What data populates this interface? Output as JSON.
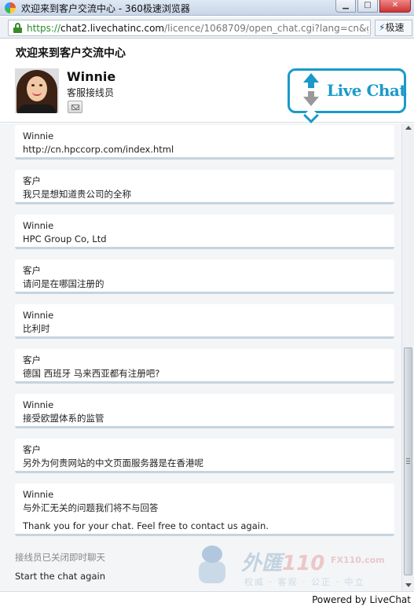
{
  "window": {
    "title": "欢迎来到客户交流中心 - 360极速浏览器",
    "minimize_icon": "minimize-icon",
    "maximize_icon": "maximize-icon",
    "close_icon": "close-icon"
  },
  "address_bar": {
    "protocol": "https://",
    "host": "chat2.livechatinc.com",
    "path": "/licence/1068709/open_chat.cgi?lang=cn&grou",
    "speed_button_icon": "lightning-icon",
    "speed_button_label": "极速"
  },
  "header": {
    "welcome": "欢迎来到客户交流中心",
    "agent_name": "Winnie",
    "agent_role": "客服接线员",
    "logo_text": "Live Chat"
  },
  "messages": [
    {
      "author": "Winnie",
      "text": "http://cn.hpccorp.com/index.html"
    },
    {
      "author": "客户",
      "text": "我只是想知道贵公司的全称"
    },
    {
      "author": "Winnie",
      "text": "HPC Group Co, Ltd"
    },
    {
      "author": "客户",
      "text": "请问是在哪国注册的"
    },
    {
      "author": "Winnie",
      "text": "比利时"
    },
    {
      "author": "客户",
      "text": "德国 西班牙 马来西亚都有注册吧?"
    },
    {
      "author": "Winnie",
      "text": "接受欧盟体系的监管"
    },
    {
      "author": "客户",
      "text": "另外为何贵网站的中文页面服务器是在香港呢"
    },
    {
      "author": "Winnie",
      "text": "与外汇无关的问题我们将不与回答",
      "text2": "Thank you for your chat. Feel free to contact us again."
    }
  ],
  "chat_status": "接线员已关闭即时聊天",
  "restart_label": "Start the chat again",
  "watermark": {
    "brand_prefix": "外匯",
    "brand_number": "110",
    "site": "FX110.com",
    "tagline": "权威 · 客观 · 公正 · 中立"
  },
  "footer": {
    "powered_by": "Powered by LiveChat"
  }
}
